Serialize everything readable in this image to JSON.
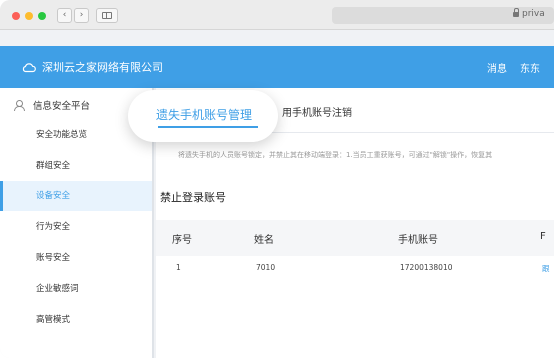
{
  "browser": {
    "url_text": "privа"
  },
  "header": {
    "company_name": "深圳云之家网络有限公司",
    "messages_label": "消息",
    "user_label": "东东"
  },
  "sidebar": {
    "title": "信息安全平台",
    "items": [
      {
        "label": "安全功能总览"
      },
      {
        "label": "群组安全"
      },
      {
        "label": "设备安全"
      },
      {
        "label": "行为安全"
      },
      {
        "label": "账号安全"
      },
      {
        "label": "企业敏感词"
      },
      {
        "label": "高管模式"
      }
    ]
  },
  "tabs": {
    "active": "遗失手机账号管理",
    "other": "用手机账号注销"
  },
  "main": {
    "description": "将遗失手机的人员账号锁定，并禁止其在移动端登录：1.当员工重获账号，可通过\"解锁\"操作，恢复其",
    "section_title": "禁止登录账号",
    "table": {
      "headers": [
        "序号",
        "姓名",
        "手机账号",
        "F"
      ],
      "rows": [
        [
          "1",
          "7010",
          "17200138010",
          "跟"
        ]
      ]
    }
  },
  "colors": {
    "accent": "#3f9fe6",
    "header_bg": "#3f9fe6"
  }
}
